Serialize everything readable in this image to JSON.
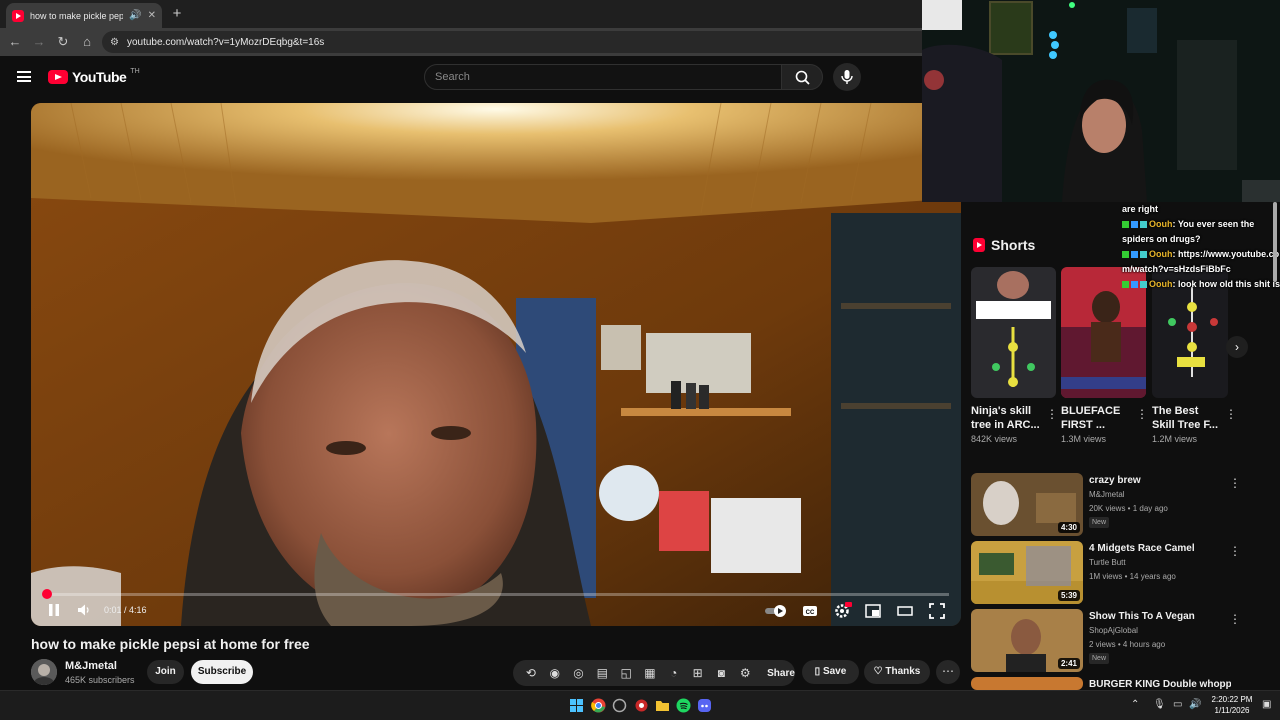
{
  "browser": {
    "tab_title": "how to make pickle pepsi at home for free",
    "url": "youtube.com/watch?v=1yMozrDEqbg&t=16s"
  },
  "header": {
    "logo_text": "YouTube",
    "country_code": "TH",
    "search_placeholder": "Search"
  },
  "player": {
    "current_time": "0:01",
    "duration": "4:16",
    "progress_fraction": 0.004
  },
  "video": {
    "title": "how to make pickle pepsi at home for free",
    "channel_name": "M&Jmetal",
    "subscribers": "465K subscribers",
    "join_label": "Join",
    "subscribe_label": "Subscribe",
    "share_label": "Share",
    "save_label": "Save",
    "thanks_label": "Thanks"
  },
  "shorts": {
    "heading": "Shorts",
    "items": [
      {
        "title": "Ninja's skill tree in ARC...",
        "views": "842K views"
      },
      {
        "title": "BLUEFACE FIRST ...",
        "views": "1.3M views"
      },
      {
        "title": "The Best Skill Tree F...",
        "views": "1.2M views"
      }
    ]
  },
  "recommendations": [
    {
      "title": "crazy brew",
      "channel": "M&Jmetal",
      "meta": "20K views • 1 day ago",
      "badge": "New",
      "duration": "4:30"
    },
    {
      "title": "4 Midgets Race Camel",
      "channel": "Turtle Butt",
      "meta": "1M views • 14 years ago",
      "badge": "",
      "duration": "5:39"
    },
    {
      "title": "Show This To A Vegan",
      "channel": "ShopAjGlobal",
      "meta": "2 views • 4 hours ago",
      "badge": "New",
      "duration": "2:41"
    },
    {
      "title": "BURGER KING Double whopper",
      "channel": "",
      "meta": "",
      "badge": "",
      "duration": ""
    }
  ],
  "chat": [
    {
      "user": "",
      "text": "are right"
    },
    {
      "user": "Oouh",
      "text": "You ever seen the spiders on drugs?"
    },
    {
      "user": "Oouh",
      "text": "https://www.youtube.com/watch?v=sHzdsFiBbFc"
    },
    {
      "user": "Oouh",
      "text": "look how old this shit is"
    }
  ],
  "taskbar": {
    "time": "2:20:22 PM",
    "date": "1/11/2026"
  },
  "colors": {
    "brand_red": "#ff0033",
    "background": "#0f0f0f",
    "chat_name": "#e8b52a"
  }
}
